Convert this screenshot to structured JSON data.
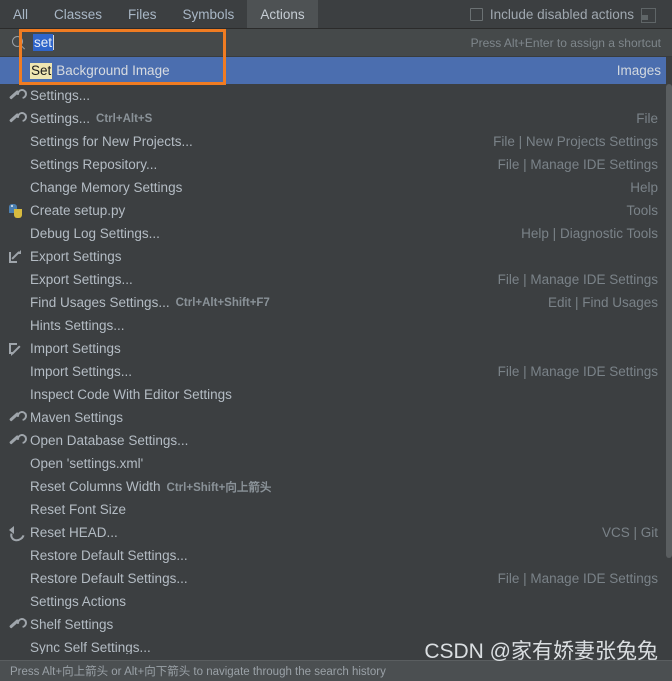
{
  "window": {
    "title": "Search Everywhere"
  },
  "tabs": [
    {
      "label": "All",
      "active": false
    },
    {
      "label": "Classes",
      "active": false
    },
    {
      "label": "Files",
      "active": false
    },
    {
      "label": "Symbols",
      "active": false
    },
    {
      "label": "Actions",
      "active": true
    }
  ],
  "toolbar": {
    "include_disabled_label": "Include disabled actions",
    "include_disabled_checked": false,
    "window_icon": "window-icon"
  },
  "search": {
    "icon": "search-icon",
    "value": "set",
    "value_selected": true,
    "hint": "Press Alt+Enter to assign a shortcut"
  },
  "selected_result": {
    "match": "Set",
    "rest": "Background Image",
    "group": "Images"
  },
  "colors": {
    "background": "#3c3f41",
    "selection": "#4b6eaf",
    "highlight_box": "#f07c22",
    "match_highlight": "#efe6b2",
    "text": "#b4bcc4",
    "secondary_text": "#7a8288",
    "search_selection": "#2f65ca",
    "tab_active": "#4e5254"
  },
  "results": [
    {
      "icon": "wrench-icon",
      "label": "Settings...",
      "shortcut": "",
      "group": ""
    },
    {
      "icon": "wrench-icon",
      "label": "Settings...",
      "shortcut": "Ctrl+Alt+S",
      "group": "File"
    },
    {
      "icon": "none",
      "label": "Settings for New Projects...",
      "shortcut": "",
      "group": "File | New Projects Settings"
    },
    {
      "icon": "none",
      "label": "Settings Repository...",
      "shortcut": "",
      "group": "File | Manage IDE Settings"
    },
    {
      "icon": "none",
      "label": "Change Memory Settings",
      "shortcut": "",
      "group": "Help"
    },
    {
      "icon": "python-icon",
      "label": "Create setup.py",
      "shortcut": "",
      "group": "Tools"
    },
    {
      "icon": "none",
      "label": "Debug Log Settings...",
      "shortcut": "",
      "group": "Help | Diagnostic Tools"
    },
    {
      "icon": "export-icon",
      "label": "Export Settings",
      "shortcut": "",
      "group": ""
    },
    {
      "icon": "none",
      "label": "Export Settings...",
      "shortcut": "",
      "group": "File | Manage IDE Settings"
    },
    {
      "icon": "none",
      "label": "Find Usages Settings...",
      "shortcut": "Ctrl+Alt+Shift+F7",
      "group": "Edit | Find Usages"
    },
    {
      "icon": "none",
      "label": "Hints Settings...",
      "shortcut": "",
      "group": ""
    },
    {
      "icon": "import-icon",
      "label": "Import Settings",
      "shortcut": "",
      "group": ""
    },
    {
      "icon": "none",
      "label": "Import Settings...",
      "shortcut": "",
      "group": "File | Manage IDE Settings"
    },
    {
      "icon": "none",
      "label": "Inspect Code With Editor Settings",
      "shortcut": "",
      "group": ""
    },
    {
      "icon": "wrench-icon",
      "label": "Maven Settings",
      "shortcut": "",
      "group": ""
    },
    {
      "icon": "wrench-icon",
      "label": "Open Database Settings...",
      "shortcut": "",
      "group": ""
    },
    {
      "icon": "none",
      "label": "Open 'settings.xml'",
      "shortcut": "",
      "group": ""
    },
    {
      "icon": "none",
      "label": "Reset Columns Width",
      "shortcut": "Ctrl+Shift+向上箭头",
      "group": ""
    },
    {
      "icon": "none",
      "label": "Reset Font Size",
      "shortcut": "",
      "group": ""
    },
    {
      "icon": "undo-icon",
      "label": "Reset HEAD...",
      "shortcut": "",
      "group": "VCS | Git"
    },
    {
      "icon": "none",
      "label": "Restore Default Settings...",
      "shortcut": "",
      "group": ""
    },
    {
      "icon": "none",
      "label": "Restore Default Settings...",
      "shortcut": "",
      "group": "File | Manage IDE Settings"
    },
    {
      "icon": "none",
      "label": "Settings Actions",
      "shortcut": "",
      "group": ""
    },
    {
      "icon": "wrench-icon",
      "label": "Shelf Settings",
      "shortcut": "",
      "group": ""
    },
    {
      "icon": "none",
      "label": "Sync Self Settings...",
      "shortcut": "",
      "group": ""
    }
  ],
  "statusbar": {
    "text": "Press Alt+向上箭头 or Alt+向下箭头 to navigate through the search history"
  },
  "watermark": {
    "text": "CSDN @家有娇妻张兔兔"
  }
}
